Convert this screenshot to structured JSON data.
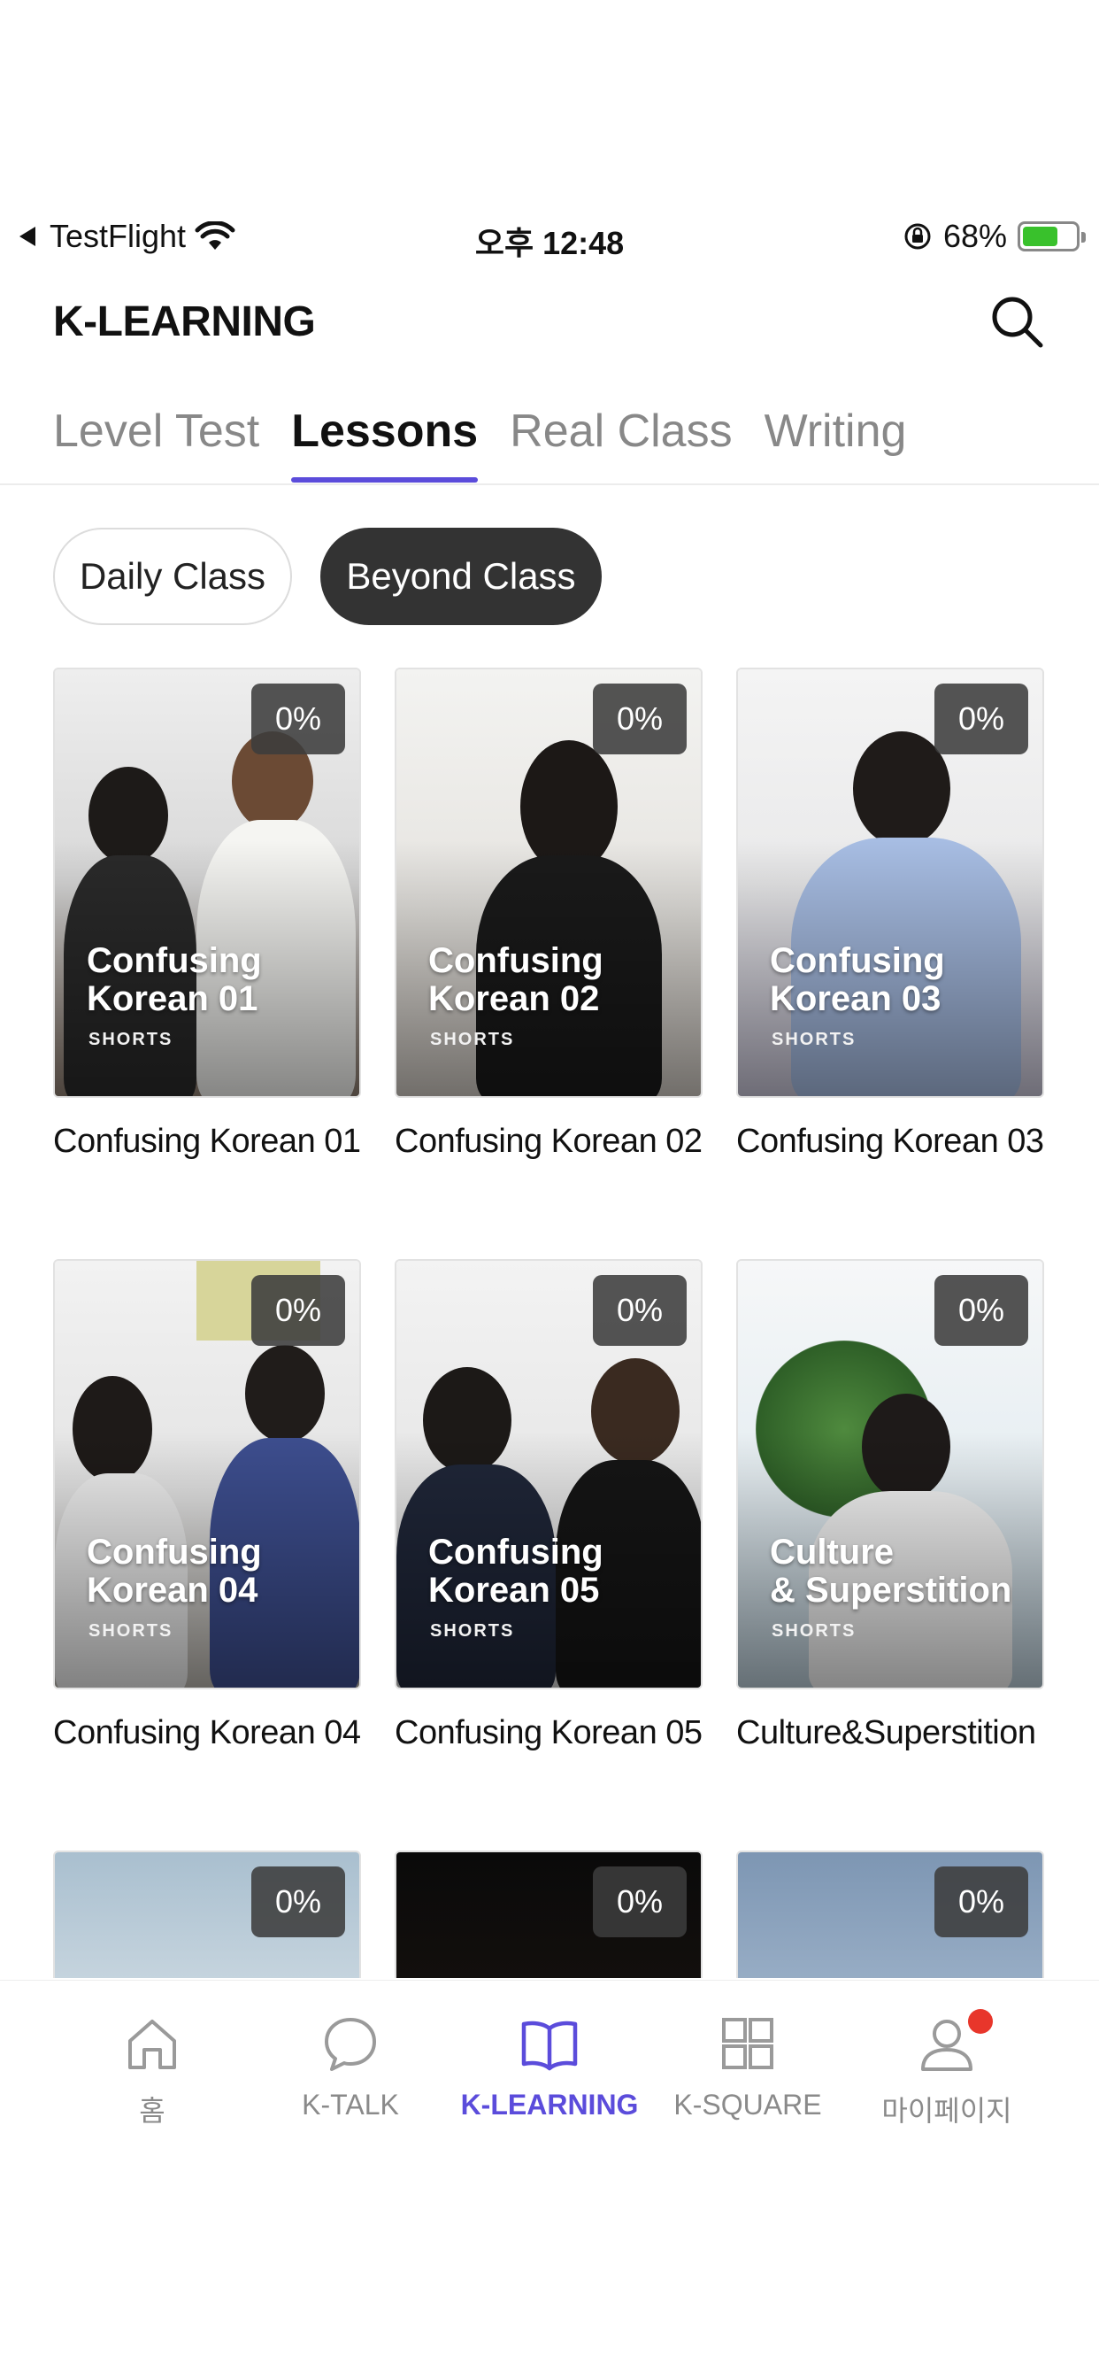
{
  "status_bar": {
    "app": "TestFlight",
    "time": "오후 12:48",
    "battery": "68%",
    "battery_level": 0.68,
    "icons": [
      "back-arrow-icon",
      "wifi-icon",
      "rotation-lock-icon",
      "battery-charging-icon"
    ]
  },
  "header": {
    "title": "K-LEARNING",
    "search_icon": "search-icon"
  },
  "tabs": [
    {
      "label": "Level Test",
      "active": false
    },
    {
      "label": "Lessons",
      "active": true
    },
    {
      "label": "Real Class",
      "active": false
    },
    {
      "label": "Writing",
      "active": false
    }
  ],
  "filters": [
    {
      "label": "Daily Class",
      "selected": false
    },
    {
      "label": "Beyond Class",
      "selected": true
    }
  ],
  "lessons": [
    {
      "title": "Confusing Korean 01",
      "overlay": "Confusing\nKorean 01",
      "tag": "SHORTS",
      "progress": "0%"
    },
    {
      "title": "Confusing Korean 02",
      "overlay": "Confusing\nKorean 02",
      "tag": "SHORTS",
      "progress": "0%"
    },
    {
      "title": "Confusing Korean 03",
      "overlay": "Confusing\nKorean 03",
      "tag": "SHORTS",
      "progress": "0%"
    },
    {
      "title": "Confusing Korean 04",
      "overlay": "Confusing\nKorean 04",
      "tag": "SHORTS",
      "progress": "0%"
    },
    {
      "title": "Confusing Korean 05",
      "overlay": "Confusing\nKorean 05",
      "tag": "SHORTS",
      "progress": "0%"
    },
    {
      "title": "Culture&Superstition",
      "overlay": "Culture\n& Superstition",
      "tag": "SHORTS",
      "progress": "0%"
    },
    {
      "title": "",
      "overlay": "",
      "tag": "",
      "progress": "0%"
    },
    {
      "title": "",
      "overlay": "",
      "tag": "",
      "progress": "0%"
    },
    {
      "title": "",
      "overlay": "",
      "tag": "",
      "progress": "0%"
    }
  ],
  "bottom_nav": [
    {
      "label": "홈",
      "icon": "home-icon",
      "active": false
    },
    {
      "label": "K-TALK",
      "icon": "chat-bubble-icon",
      "active": false
    },
    {
      "label": "K-LEARNING",
      "icon": "open-book-icon",
      "active": true
    },
    {
      "label": "K-SQUARE",
      "icon": "grid-squares-icon",
      "active": false
    },
    {
      "label": "마이페이지",
      "icon": "person-icon",
      "active": false,
      "notification_dot": true
    }
  ],
  "colors": {
    "accent": "#5b4cdb",
    "selected_pill": "#333333",
    "notification": "#e8362b",
    "battery": "#39c12c"
  }
}
